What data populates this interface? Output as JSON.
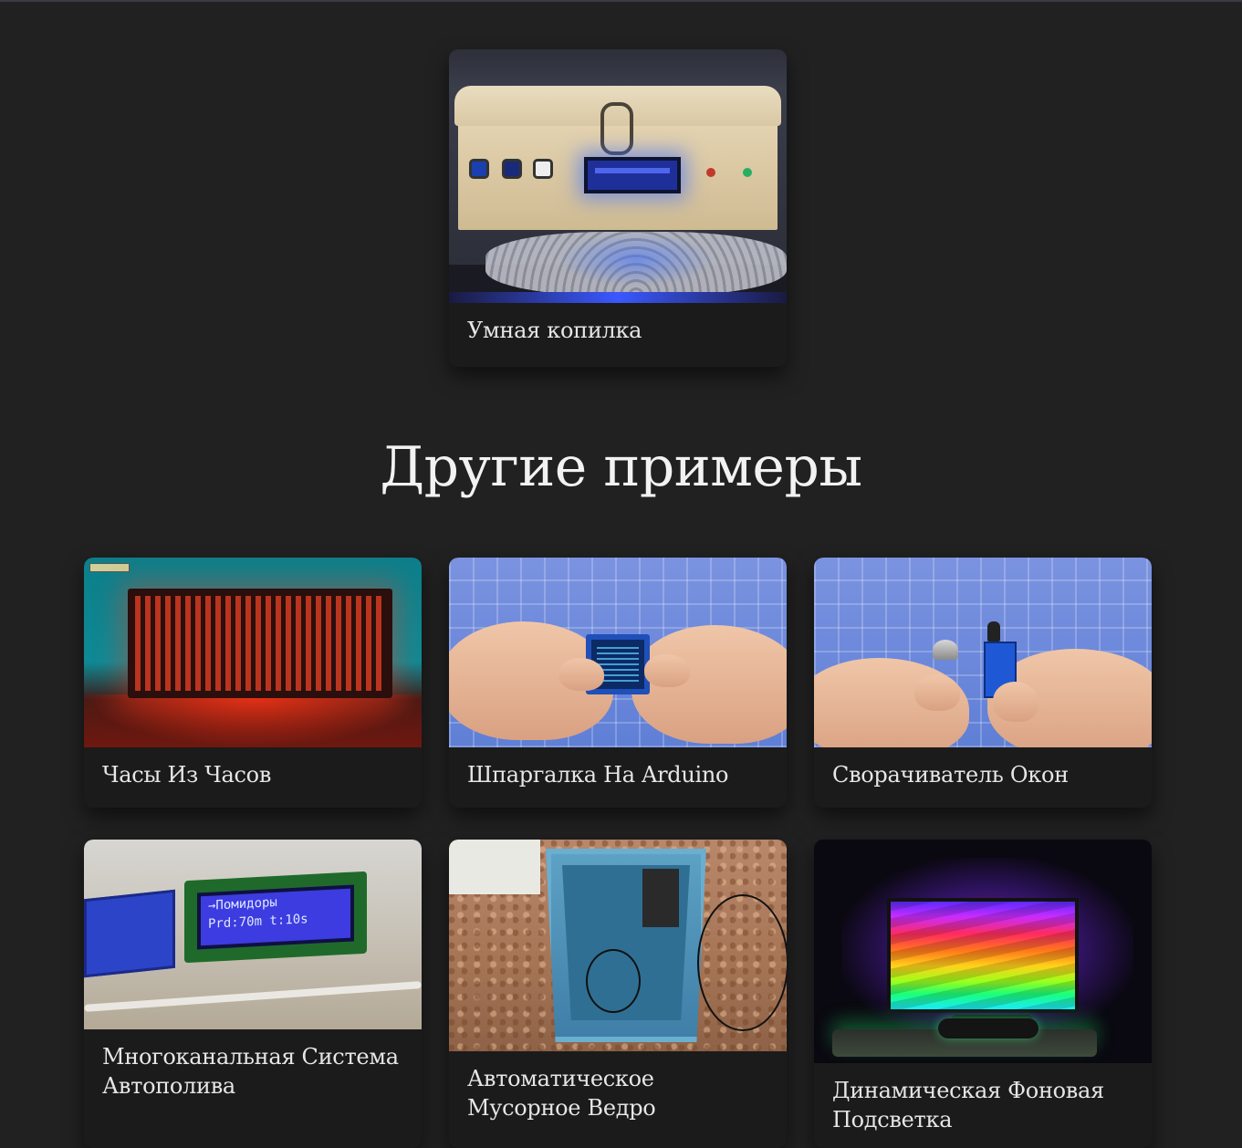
{
  "featured": {
    "title": "Умная копилка"
  },
  "section": {
    "title": "Другие примеры"
  },
  "examples": [
    {
      "title": "Часы Из Часов",
      "thumb_icon": "red-led-clock-image"
    },
    {
      "title": "Шпаргалка На Arduino",
      "thumb_icon": "oled-display-hands-image"
    },
    {
      "title": "Сворачиватель Окон",
      "thumb_icon": "ir-sensor-hands-image"
    },
    {
      "title": "Многоканальная Система Автополива",
      "thumb_icon": "watering-system-lcd-image",
      "lcd_line1": "→Помидоры",
      "lcd_line2": "Prd:70m  t:10s"
    },
    {
      "title": "Автоматическое Мусорное Ведро",
      "thumb_icon": "trash-bin-image"
    },
    {
      "title": "Динамическая Фоновая Подсветка",
      "thumb_icon": "ambient-backlight-tv-image"
    }
  ],
  "colors": {
    "background": "#212121",
    "card": "#1b1b1b",
    "text": "#e6e6e6"
  }
}
